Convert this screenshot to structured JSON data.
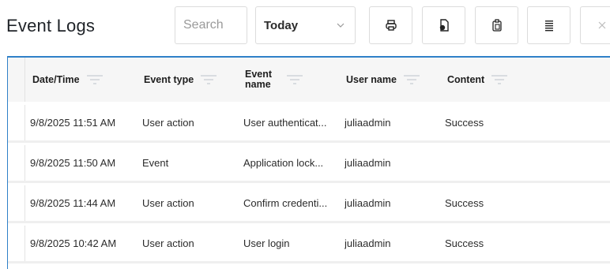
{
  "page": {
    "title": "Event Logs"
  },
  "toolbar": {
    "search_placeholder": "Search",
    "range_value": "Today"
  },
  "table": {
    "columns": [
      {
        "key": "datetime",
        "label": "Date/Time"
      },
      {
        "key": "event_type",
        "label": "Event type"
      },
      {
        "key": "event_name",
        "label": "Event name"
      },
      {
        "key": "user_name",
        "label": "User name"
      },
      {
        "key": "content",
        "label": "Content"
      }
    ],
    "rows": [
      {
        "datetime": "9/8/2025 11:51 AM",
        "event_type": "User action",
        "event_name": "User authenticat...",
        "user_name": "juliaadmin",
        "content": "Success"
      },
      {
        "datetime": "9/8/2025 11:50 AM",
        "event_type": "Event",
        "event_name": "Application lock...",
        "user_name": "juliaadmin",
        "content": ""
      },
      {
        "datetime": "9/8/2025 11:44 AM",
        "event_type": "User action",
        "event_name": "Confirm credenti...",
        "user_name": "juliaadmin",
        "content": "Success"
      },
      {
        "datetime": "9/8/2025 10:42 AM",
        "event_type": "User action",
        "event_name": "User login",
        "user_name": "juliaadmin",
        "content": "Success"
      }
    ]
  },
  "icons": {
    "print": "print-icon",
    "export": "export-file-icon",
    "copy": "copy-icon",
    "columns": "columns-icon",
    "close": "close-icon"
  },
  "colors": {
    "accent": "#2f80c8",
    "header_bg": "#f6f6f6"
  }
}
